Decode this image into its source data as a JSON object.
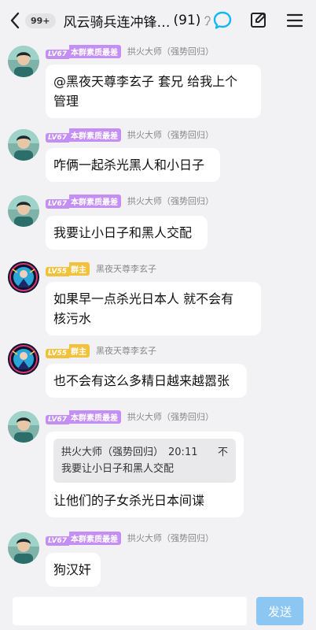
{
  "header": {
    "unread_badge": "99+",
    "title": "风云骑兵连冲锋…",
    "member_count": "(91)"
  },
  "colors": {
    "accent": "#12b7f5",
    "tag_purple": "#c48ff4",
    "tag_yellow": "#f3c23c",
    "send_button": "#8cc7f3"
  },
  "messages": [
    {
      "level": "LV67",
      "title_tag": "本群素质最差",
      "sender": "拱火大师（强势回归）",
      "text_line1": "@黑夜天尊李玄子 套兄 给我上个",
      "text_line2": "管理"
    },
    {
      "level": "LV67",
      "title_tag": "本群素质最差",
      "sender": "拱火大师（强势回归）",
      "text": "咋俩一起杀光黑人和小日子"
    },
    {
      "level": "LV67",
      "title_tag": "本群素质最差",
      "sender": "拱火大师（强势回归）",
      "text": "我要让小日子和黑人交配"
    },
    {
      "level": "LV55",
      "title_tag": "群主",
      "sender": "黑夜天尊李玄子",
      "text_line1": "如果早一点杀光日本人 就不会有",
      "text_line2": "核污水"
    },
    {
      "level": "LV55",
      "title_tag": "群主",
      "sender": "黑夜天尊李玄子",
      "text": "也不会有这么多精日越来越嚣张"
    },
    {
      "level": "LV67",
      "title_tag": "本群素质最差",
      "sender": "拱火大师（强势回归）",
      "quote_sender": "拱火大师（强势回归）",
      "quote_time": "20:11",
      "quote_more": "不",
      "quote_text": "我要让小日子和黑人交配",
      "text": "让他们的子女杀光日本间谍"
    },
    {
      "level": "LV67",
      "title_tag": "本群素质最差",
      "sender": "拱火大师（强势回归）",
      "text": "狗汉奸"
    }
  ],
  "input": {
    "placeholder": "",
    "send_label": "发送"
  }
}
